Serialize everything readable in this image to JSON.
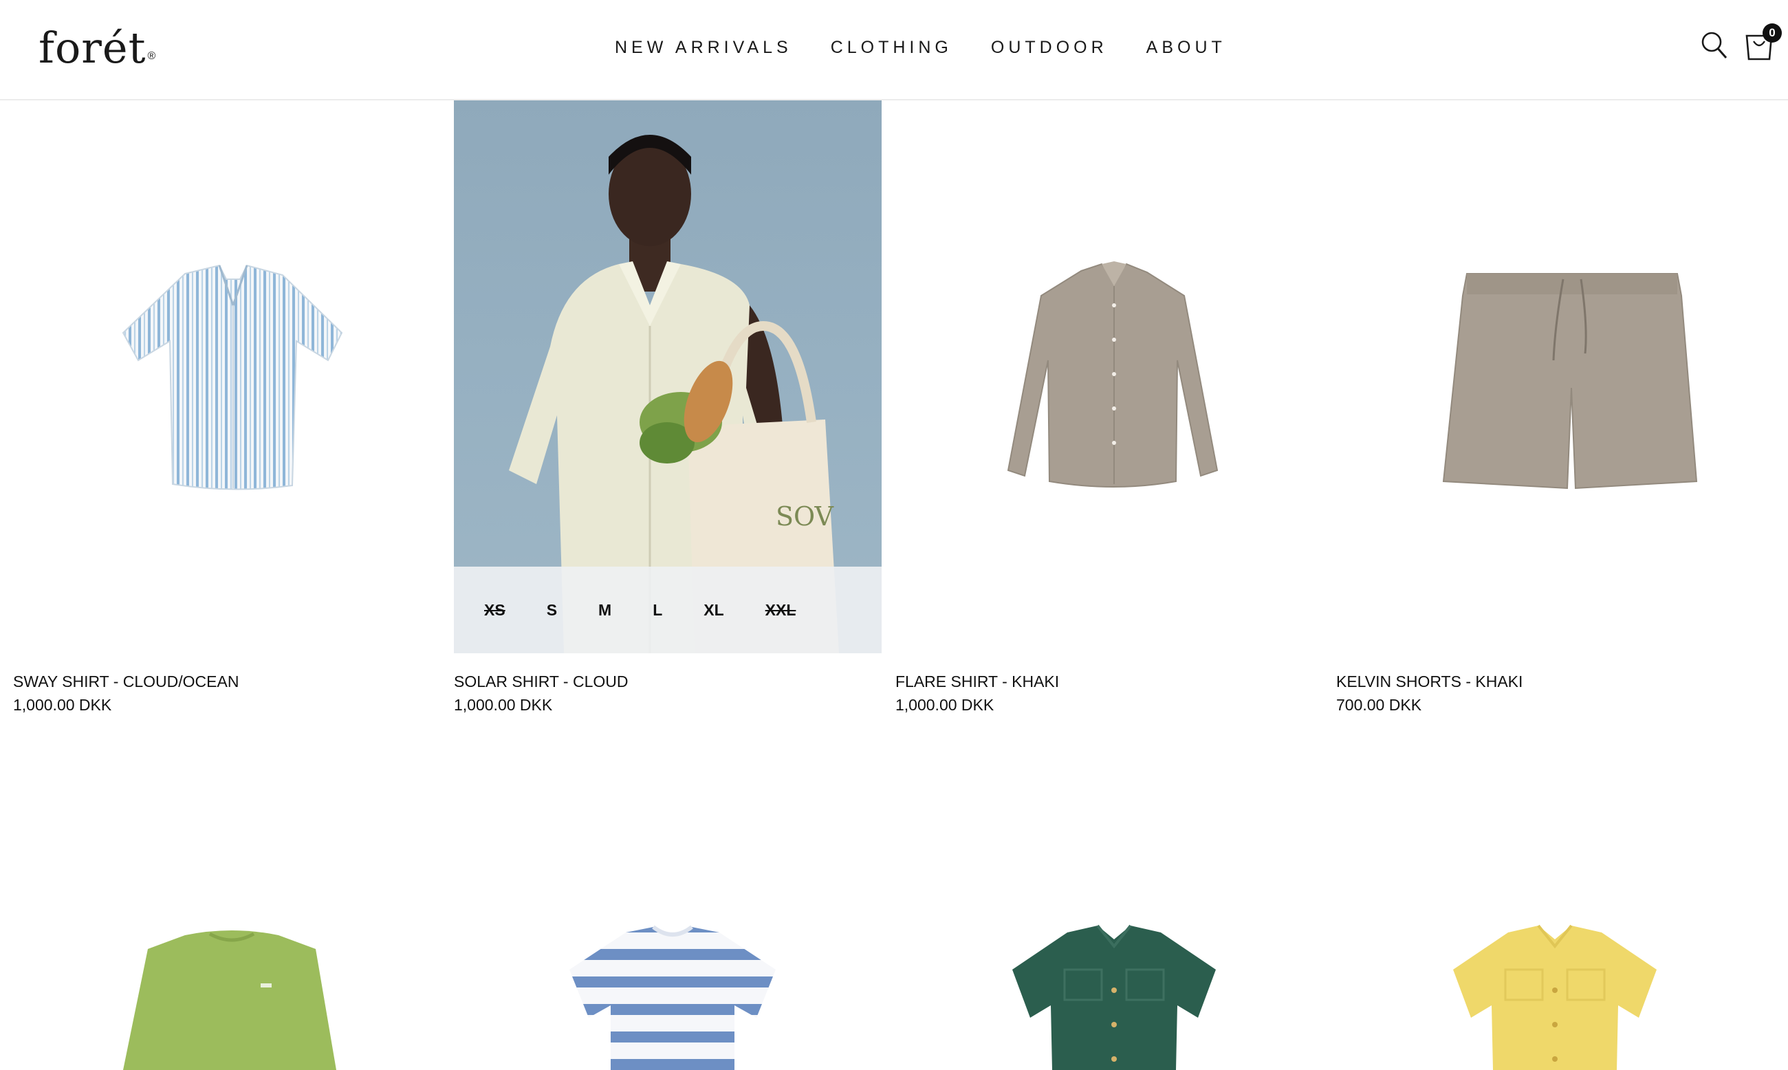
{
  "header": {
    "logo_text": "forét",
    "logo_mark": "®",
    "nav": [
      "NEW ARRIVALS",
      "CLOTHING",
      "OUTDOOR",
      "ABOUT"
    ],
    "cart_count": "0"
  },
  "products": [
    {
      "title": "SWAY SHIRT - CLOUD/OCEAN",
      "price": "1,000.00 DKK"
    },
    {
      "title": "SOLAR SHIRT - CLOUD",
      "price": "1,000.00 DKK",
      "bag_print": "SOV"
    },
    {
      "title": "FLARE SHIRT - KHAKI",
      "price": "1,000.00 DKK"
    },
    {
      "title": "KELVIN SHORTS - KHAKI",
      "price": "700.00 DKK"
    }
  ],
  "sizes": [
    {
      "label": "XS",
      "available": false
    },
    {
      "label": "S",
      "available": true
    },
    {
      "label": "M",
      "available": true
    },
    {
      "label": "L",
      "available": true
    },
    {
      "label": "XL",
      "available": true
    },
    {
      "label": "XXL",
      "available": false
    }
  ],
  "colors": {
    "cloud_ocean_stripe": "#8fb6d8",
    "khaki": "#a89e92",
    "green_tee": "#9cbc5c",
    "stripe_blue": "#6d8fc4",
    "dark_green": "#2b5e4e",
    "yellow": "#efd86a",
    "studio_blue": "#93adbf"
  }
}
